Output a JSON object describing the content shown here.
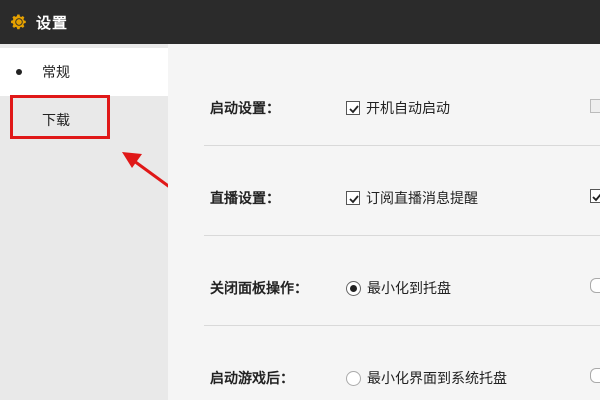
{
  "window": {
    "title": "设置",
    "icon": "gear-icon",
    "accent": "#e6a100"
  },
  "sidebar": {
    "items": [
      {
        "label": "常规",
        "active": true
      },
      {
        "label": "下载",
        "active": false
      }
    ],
    "highlight_color": "#e01818"
  },
  "settings": {
    "startup": {
      "label": "启动设置：",
      "option": "开机自动启动",
      "checked": true
    },
    "live": {
      "label": "直播设置：",
      "option": "订阅直播消息提醒",
      "checked": true
    },
    "close_panel": {
      "label": "关闭面板操作：",
      "option": "最小化到托盘",
      "selected": true
    },
    "after_game": {
      "label": "启动游戏后：",
      "option": "最小化界面到系统托盘",
      "selected": false
    }
  }
}
